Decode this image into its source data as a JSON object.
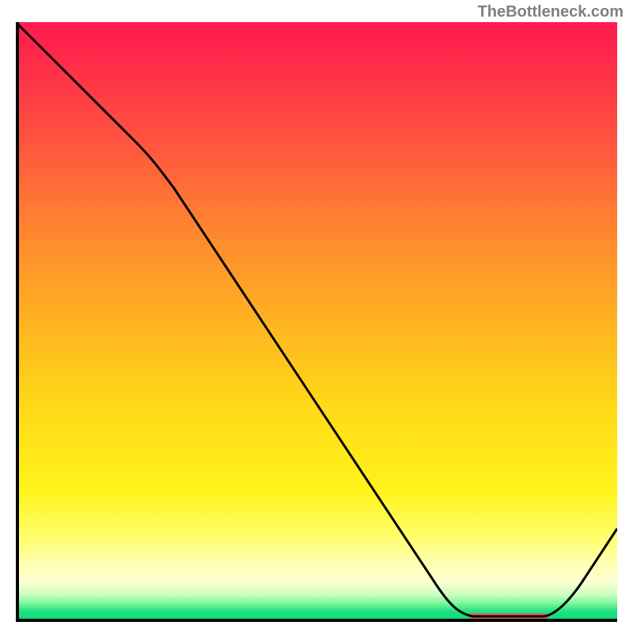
{
  "watermark": "TheBottleneck.com",
  "chart_data": {
    "type": "line",
    "title": "",
    "xlabel": "",
    "ylabel": "",
    "xlim": [
      0,
      100
    ],
    "ylim": [
      0,
      100
    ],
    "grid": false,
    "legend": false,
    "series": [
      {
        "name": "bottleneck-curve",
        "x": [
          0,
          8,
          20,
          30,
          40,
          50,
          60,
          70,
          76,
          80,
          86,
          90,
          94,
          100
        ],
        "values": [
          100,
          92,
          80,
          68,
          55,
          42,
          29,
          16,
          6,
          1,
          0,
          3,
          9,
          20
        ]
      }
    ],
    "annotations": [
      {
        "name": "optimal-band",
        "type": "hspan",
        "x_start": 76,
        "x_end": 88,
        "y": 0.5,
        "color": "#d06a5c"
      }
    ],
    "background_gradient": {
      "direction": "vertical",
      "stops": [
        {
          "pos": 0.0,
          "color": "#ff1a4d"
        },
        {
          "pos": 0.36,
          "color": "#ff8a2e"
        },
        {
          "pos": 0.64,
          "color": "#ffd918"
        },
        {
          "pos": 0.86,
          "color": "#ffff6e"
        },
        {
          "pos": 0.955,
          "color": "#c8ffbf"
        },
        {
          "pos": 1.0,
          "color": "#00d977"
        }
      ]
    }
  }
}
